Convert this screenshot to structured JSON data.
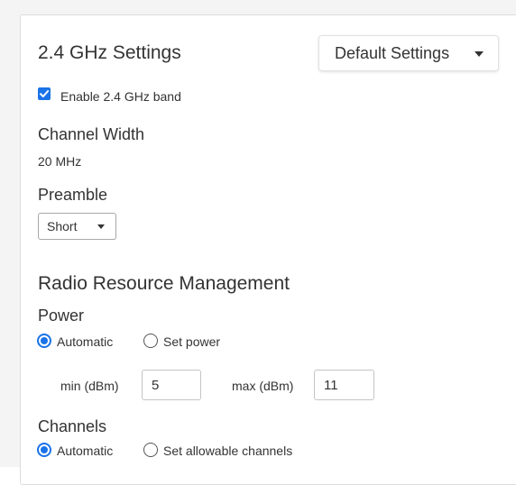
{
  "settings": {
    "title": "2.4 GHz Settings",
    "preset_dropdown": "Default Settings",
    "enable_band_label": "Enable 2.4 GHz band",
    "enable_band_checked": true,
    "channel_width_label": "Channel Width",
    "channel_width_value": "20 MHz",
    "preamble_label": "Preamble",
    "preamble_value": "Short"
  },
  "rrm": {
    "title": "Radio Resource Management",
    "power": {
      "label": "Power",
      "option_automatic": "Automatic",
      "option_set": "Set power",
      "selected": "Automatic",
      "min_label": "min (dBm)",
      "min_value": "5",
      "max_label": "max (dBm)",
      "max_value": "11"
    },
    "channels": {
      "label": "Channels",
      "option_automatic": "Automatic",
      "option_set": "Set allowable channels",
      "selected": "Automatic"
    }
  },
  "colors": {
    "accent": "#1a73e8",
    "text": "#333333",
    "panel_border": "#dcdcdc"
  },
  "icons": {
    "dropdown": "chevron-down-icon",
    "checkbox": "checkmark-icon"
  }
}
